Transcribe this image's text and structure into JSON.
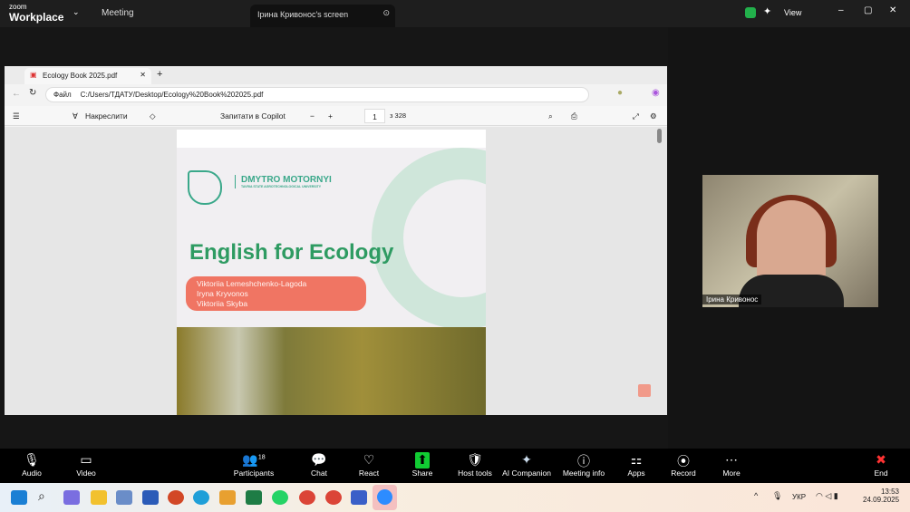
{
  "zoom": {
    "logo_small": "zoom",
    "logo_big": "Workplace",
    "meeting": "Meeting",
    "share_tab": "Ірина Кривонос's screen",
    "view": "View"
  },
  "browser": {
    "tab_title": "Ecology Book 2025.pdf",
    "file_label": "Файл",
    "url": "C:/Users/ТДАТУ/Desktop/Ecology%20Book%202025.pdf",
    "draw": "Накреслити",
    "copilot": "Запитати в Copilot",
    "page": "1",
    "page_total": "з 328"
  },
  "pdf": {
    "uni_name": "DMYTRO MOTORNYI",
    "uni_sub": "TAVRIA STATE AGROTECHNOLOGICAL UNIVERSITY",
    "title": "English for Ecology",
    "authors": [
      "Viktoriia Lemeshchenko-Lagoda",
      "Iryna Kryvonos",
      "Viktoriia Skyba"
    ]
  },
  "video": {
    "name": "Ірина Кривонос"
  },
  "controls": [
    {
      "label": "Audio",
      "icon": "🎙"
    },
    {
      "label": "Video",
      "icon": "▭"
    },
    {
      "label": "Participants",
      "icon": "👥",
      "count": "18"
    },
    {
      "label": "Chat",
      "icon": "💬"
    },
    {
      "label": "React",
      "icon": "♡"
    },
    {
      "label": "Share",
      "icon": "⬆"
    },
    {
      "label": "Host tools",
      "icon": "🛡"
    },
    {
      "label": "AI Companion",
      "icon": "✦"
    },
    {
      "label": "Meeting info",
      "icon": "ⓘ"
    },
    {
      "label": "Apps",
      "icon": "⚏"
    },
    {
      "label": "Record",
      "icon": "⦿"
    },
    {
      "label": "More",
      "icon": "⋯"
    },
    {
      "label": "End",
      "icon": "✖"
    }
  ],
  "taskbar": {
    "lang": "УКР",
    "time": "13:53",
    "date": "24.09.2025"
  }
}
